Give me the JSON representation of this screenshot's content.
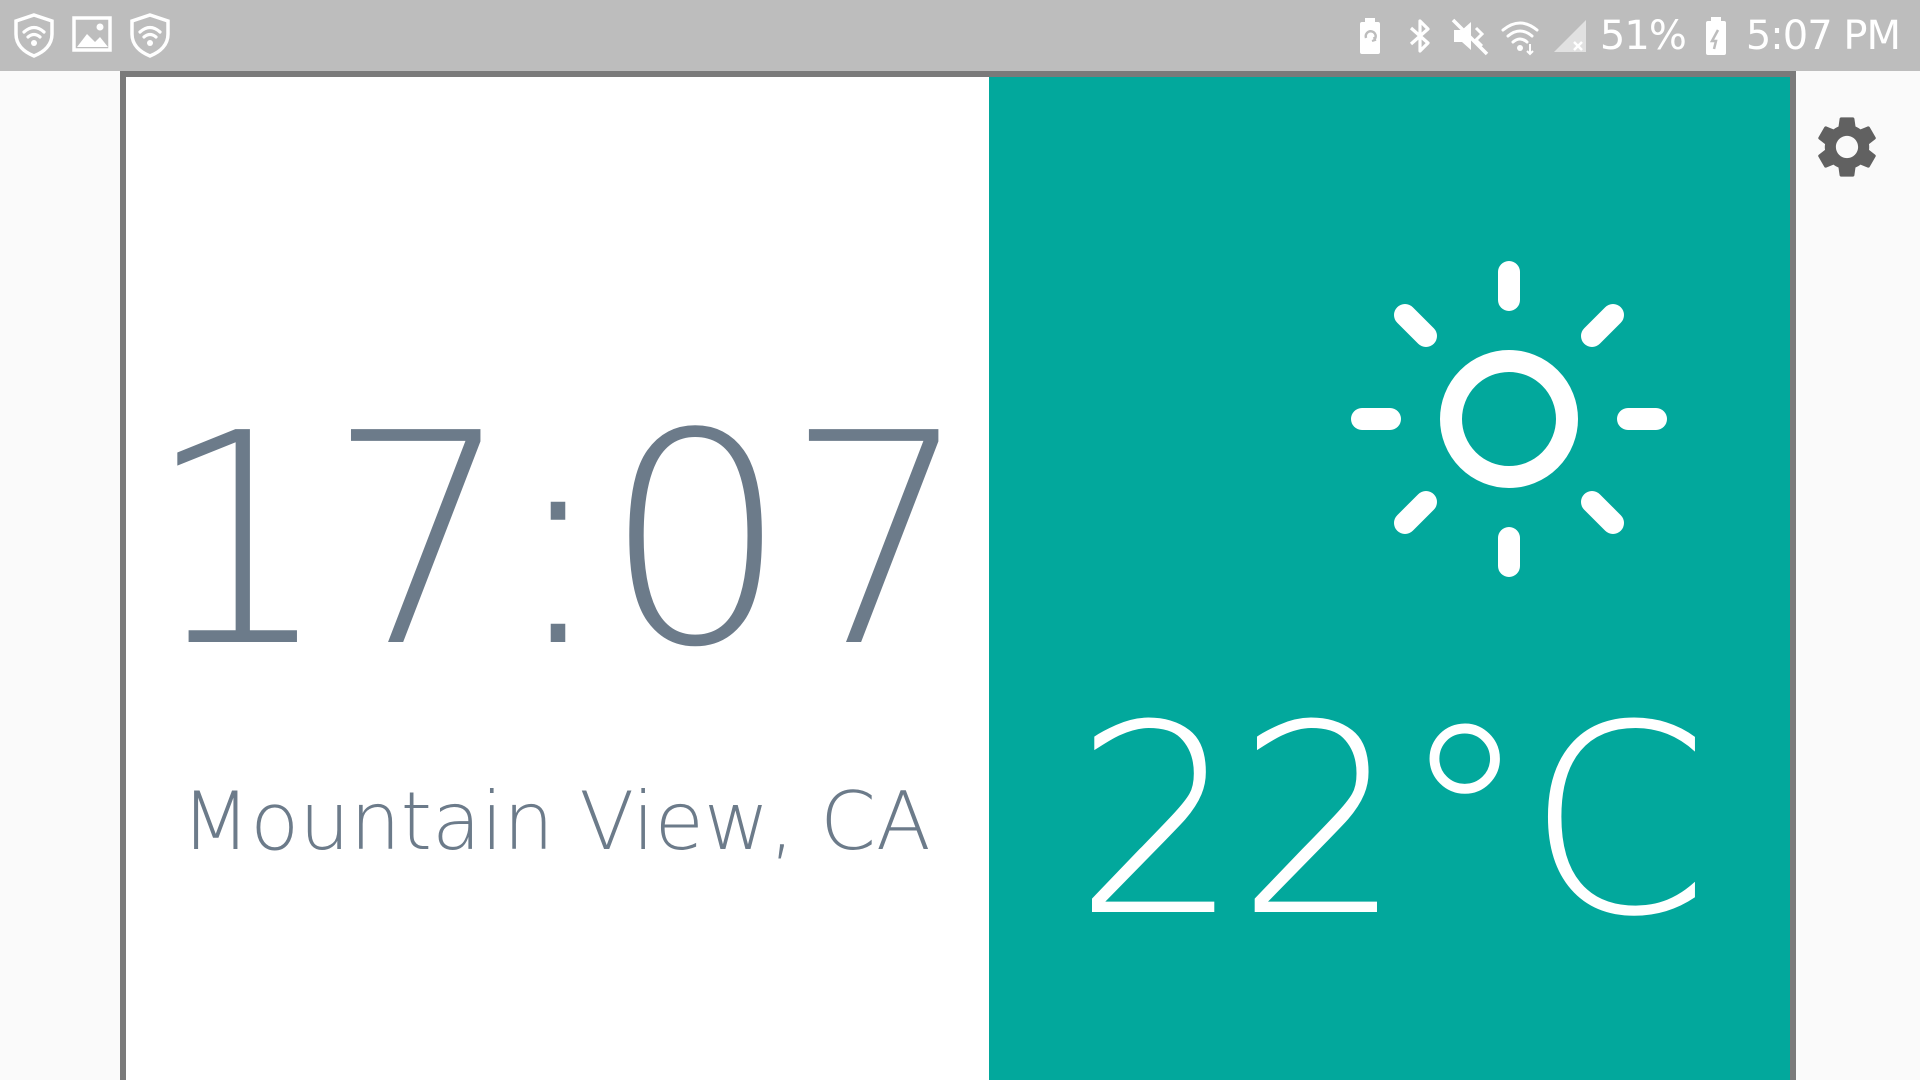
{
  "status_bar": {
    "left_icons": [
      "shield-wifi-icon",
      "image-icon",
      "shield-wifi-icon"
    ],
    "right_icons": [
      "battery-saver-icon",
      "bluetooth-icon",
      "vibrate-mute-icon",
      "wifi-icon",
      "signal-icon"
    ],
    "battery_percent": "51%",
    "time": "5:07 PM"
  },
  "clock": {
    "time": "17:07",
    "location": "Mountain View, CA"
  },
  "weather": {
    "condition_icon": "sun-icon",
    "temperature": "22°C"
  },
  "colors": {
    "weather_panel": "#02a89c",
    "clock_text": "#6c7b8a",
    "status_bar": "#bdbdbd"
  },
  "settings": {
    "icon": "gear-icon"
  }
}
